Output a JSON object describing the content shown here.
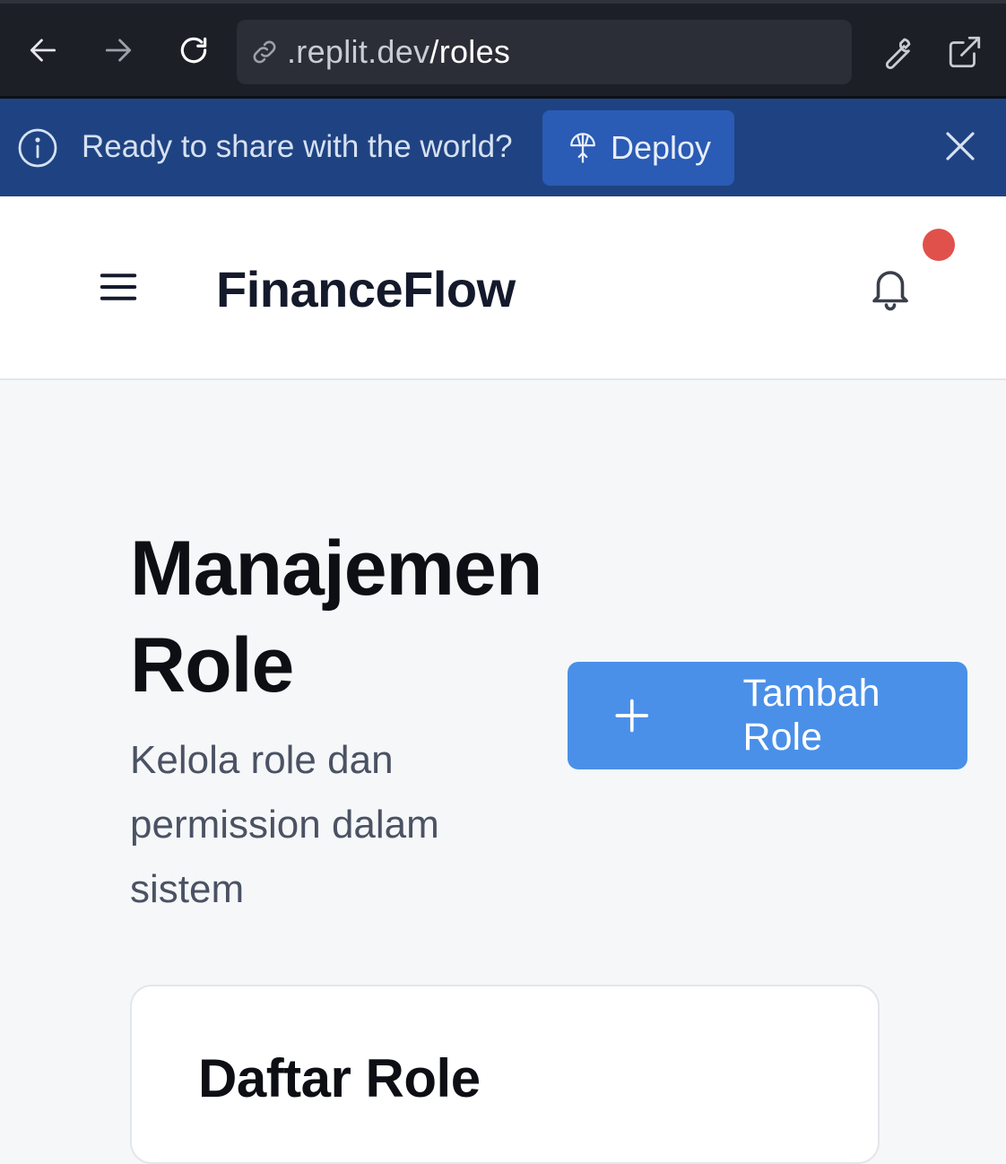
{
  "browser": {
    "url_host": ".replit.dev",
    "url_path": "/roles"
  },
  "banner": {
    "message": "Ready to share with the world?",
    "deploy_label": "Deploy",
    "background": "#1f4382"
  },
  "header": {
    "brand": "FinanceFlow",
    "notification_dot_color": "#e0514c"
  },
  "main": {
    "title": "Manajemen Role",
    "subtitle": "Kelola role dan permission dalam sistem",
    "add_button_label": "Tambah Role",
    "accent": "#4a90e8"
  },
  "card": {
    "title": "Daftar Role"
  },
  "icons": [
    "back-arrow-icon",
    "forward-arrow-icon",
    "reload-icon",
    "link-icon",
    "wrench-icon",
    "external-link-icon",
    "info-icon",
    "deploy-icon",
    "close-icon",
    "menu-icon",
    "bell-icon",
    "plus-icon"
  ]
}
